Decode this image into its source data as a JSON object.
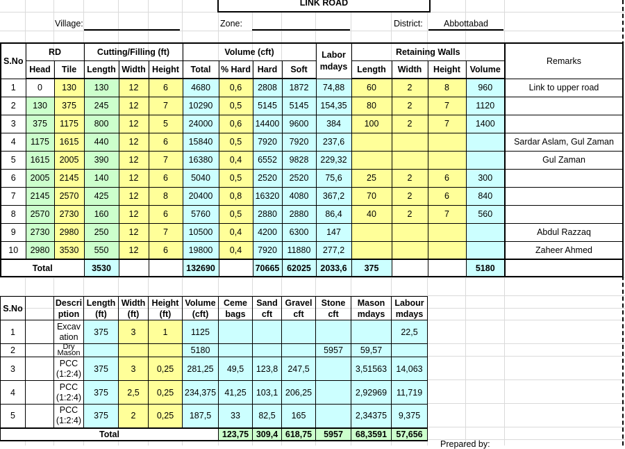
{
  "header": {
    "title": "LINK ROAD",
    "village_label": "Village:",
    "village_value": "",
    "zone_label": "Zone:",
    "zone_value": "",
    "district_label": "District:",
    "district_value": "Abbottabad"
  },
  "main_table": {
    "headers": {
      "sno": "S.No",
      "rd": "RD",
      "head": "Head",
      "tile": "Tile",
      "cutting": "Cutting/Filling (ft)",
      "length": "Length",
      "width": "Width",
      "height": "Height",
      "volume": "Volume (cft)",
      "total": "Total",
      "pct_hard": "% Hard",
      "hard": "Hard",
      "soft": "Soft",
      "labor_1": "Labor",
      "labor_2": "mdays",
      "retaining": "Retaining Walls",
      "rw_length": "Length",
      "rw_width": "Width",
      "rw_height": "Height",
      "rw_volume": "Volume",
      "remarks": "Remarks"
    },
    "rows": [
      {
        "sno": "1",
        "head": "0",
        "tile": "130",
        "length": "130",
        "width": "12",
        "height": "6",
        "total": "4680",
        "pct_hard": "0,6",
        "hard": "2808",
        "soft": "1872",
        "labor": "74,88",
        "rw_length": "60",
        "rw_width": "2",
        "rw_height": "8",
        "rw_volume": "960",
        "remarks": "Link to upper road"
      },
      {
        "sno": "2",
        "head": "130",
        "tile": "375",
        "length": "245",
        "width": "12",
        "height": "7",
        "total": "10290",
        "pct_hard": "0,5",
        "hard": "5145",
        "soft": "5145",
        "labor": "154,35",
        "rw_length": "80",
        "rw_width": "2",
        "rw_height": "7",
        "rw_volume": "1120",
        "remarks": ""
      },
      {
        "sno": "3",
        "head": "375",
        "tile": "1175",
        "length": "800",
        "width": "12",
        "height": "5",
        "total": "24000",
        "pct_hard": "0,6",
        "hard": "14400",
        "soft": "9600",
        "labor": "384",
        "rw_length": "100",
        "rw_width": "2",
        "rw_height": "7",
        "rw_volume": "1400",
        "remarks": ""
      },
      {
        "sno": "4",
        "head": "1175",
        "tile": "1615",
        "length": "440",
        "width": "12",
        "height": "6",
        "total": "15840",
        "pct_hard": "0,5",
        "hard": "7920",
        "soft": "7920",
        "labor": "237,6",
        "rw_length": "",
        "rw_width": "",
        "rw_height": "",
        "rw_volume": "",
        "remarks": "Sardar Aslam, Gul Zaman"
      },
      {
        "sno": "5",
        "head": "1615",
        "tile": "2005",
        "length": "390",
        "width": "12",
        "height": "7",
        "total": "16380",
        "pct_hard": "0,4",
        "hard": "6552",
        "soft": "9828",
        "labor": "229,32",
        "rw_length": "",
        "rw_width": "",
        "rw_height": "",
        "rw_volume": "",
        "remarks": "Gul Zaman"
      },
      {
        "sno": "6",
        "head": "2005",
        "tile": "2145",
        "length": "140",
        "width": "12",
        "height": "6",
        "total": "5040",
        "pct_hard": "0,5",
        "hard": "2520",
        "soft": "2520",
        "labor": "75,6",
        "rw_length": "25",
        "rw_width": "2",
        "rw_height": "6",
        "rw_volume": "300",
        "remarks": ""
      },
      {
        "sno": "7",
        "head": "2145",
        "tile": "2570",
        "length": "425",
        "width": "12",
        "height": "8",
        "total": "20400",
        "pct_hard": "0,8",
        "hard": "16320",
        "soft": "4080",
        "labor": "367,2",
        "rw_length": "70",
        "rw_width": "2",
        "rw_height": "6",
        "rw_volume": "840",
        "remarks": ""
      },
      {
        "sno": "8",
        "head": "2570",
        "tile": "2730",
        "length": "160",
        "width": "12",
        "height": "6",
        "total": "5760",
        "pct_hard": "0,5",
        "hard": "2880",
        "soft": "2880",
        "labor": "86,4",
        "rw_length": "40",
        "rw_width": "2",
        "rw_height": "7",
        "rw_volume": "560",
        "remarks": ""
      },
      {
        "sno": "9",
        "head": "2730",
        "tile": "2980",
        "length": "250",
        "width": "12",
        "height": "7",
        "total": "10500",
        "pct_hard": "0,4",
        "hard": "4200",
        "soft": "6300",
        "labor": "147",
        "rw_length": "",
        "rw_width": "",
        "rw_height": "",
        "rw_volume": "",
        "remarks": "Abdul Razzaq"
      },
      {
        "sno": "10",
        "head": "2980",
        "tile": "3530",
        "length": "550",
        "width": "12",
        "height": "6",
        "total": "19800",
        "pct_hard": "0,4",
        "hard": "7920",
        "soft": "11880",
        "labor": "277,2",
        "rw_length": "",
        "rw_width": "",
        "rw_height": "",
        "rw_volume": "",
        "remarks": "Zaheer Ahmed"
      }
    ],
    "total": {
      "label": "Total",
      "length": "3530",
      "total": "132690",
      "hard": "70665",
      "soft": "62025",
      "labor": "2033,6",
      "rw_length": "375",
      "rw_volume": "5180"
    }
  },
  "materials_table": {
    "headers": {
      "sno": "S.No",
      "desc": "Descri ption",
      "length": "Length (ft)",
      "width": "Width (ft)",
      "height": "Height (ft)",
      "volume": "Volume (cft)",
      "cement": "Ceme bags",
      "sand": "Sand cft",
      "gravel": "Gravel cft",
      "stone": "Stone cft",
      "mason": "Mason mdays",
      "labour": "Labour mdays"
    },
    "rows": [
      {
        "sno": "1",
        "desc": "Excav ation",
        "length": "375",
        "width": "3",
        "height": "1",
        "volume": "1125",
        "cement": "",
        "sand": "",
        "gravel": "",
        "stone": "",
        "mason": "",
        "labour": "22,5"
      },
      {
        "sno": "2",
        "desc": "Dry Mason",
        "length": "",
        "width": "",
        "height": "",
        "volume": "5180",
        "cement": "",
        "sand": "",
        "gravel": "",
        "stone": "5957",
        "mason": "59,57",
        "labour": ""
      },
      {
        "sno": "3",
        "desc": "PCC (1:2:4)",
        "length": "375",
        "width": "3",
        "height": "0,25",
        "volume": "281,25",
        "cement": "49,5",
        "sand": "123,8",
        "gravel": "247,5",
        "stone": "",
        "mason": "3,51563",
        "labour": "14,063"
      },
      {
        "sno": "4",
        "desc": "PCC (1:2:4)",
        "length": "375",
        "width": "2,5",
        "height": "0,25",
        "volume": "234,375",
        "cement": "41,25",
        "sand": "103,1",
        "gravel": "206,25",
        "stone": "",
        "mason": "2,92969",
        "labour": "11,719"
      },
      {
        "sno": "5",
        "desc": "PCC (1:2:4)",
        "length": "375",
        "width": "2",
        "height": "0,25",
        "volume": "187,5",
        "cement": "33",
        "sand": "82,5",
        "gravel": "165",
        "stone": "",
        "mason": "2,34375",
        "labour": "9,375"
      }
    ],
    "total": {
      "label": "Total",
      "cement": "123,75",
      "sand": "309,4",
      "gravel": "618,75",
      "stone": "5957",
      "mason": "68,3591",
      "labour": "57,656"
    }
  },
  "footer": {
    "prepared_by": "Prepared by:"
  }
}
